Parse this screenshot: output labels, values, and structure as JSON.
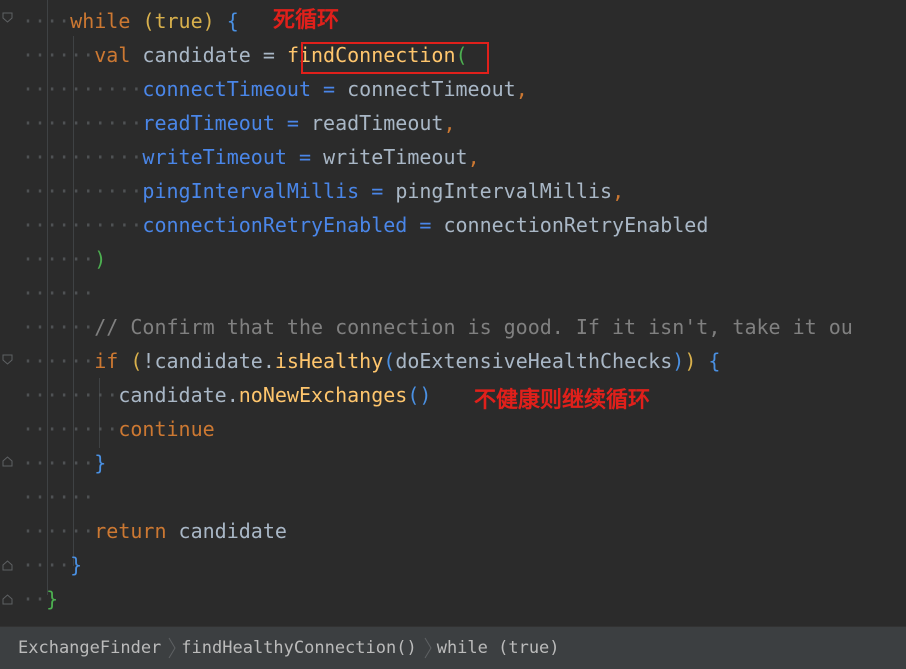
{
  "code": {
    "while_kw": "while",
    "while_cond": "(true)",
    "open_brace": "{",
    "annot_loop": "死循环",
    "val_kw": "val",
    "candidate_var": "candidate",
    "eq": "=",
    "find_fn": "findConnection",
    "open_paren": "(",
    "args": [
      {
        "name": "connectTimeout",
        "eq": "=",
        "value": "connectTimeout",
        "comma": ","
      },
      {
        "name": "readTimeout",
        "eq": "=",
        "value": "readTimeout",
        "comma": ","
      },
      {
        "name": "writeTimeout",
        "eq": "=",
        "value": "writeTimeout",
        "comma": ","
      },
      {
        "name": "pingIntervalMillis",
        "eq": "=",
        "value": "pingIntervalMillis",
        "comma": ","
      },
      {
        "name": "connectionRetryEnabled",
        "eq": "=",
        "value": "connectionRetryEnabled",
        "comma": ""
      }
    ],
    "close_paren": ")",
    "comment": "// Confirm that the connection is good. If it isn't, take it ou",
    "if_kw": "if",
    "if_open": "(",
    "if_neg": "!candidate.",
    "is_healthy_fn": "isHealthy",
    "is_healthy_open": "(",
    "is_healthy_arg": "doExtensiveHealthChecks",
    "is_healthy_close": ")",
    "if_close": ")",
    "if_brace": "{",
    "no_new_obj": "candidate.",
    "no_new_fn": "noNewExchanges",
    "no_new_parens": "()",
    "annot_continue": "不健康则继续循环",
    "continue_kw": "continue",
    "if_end_brace": "}",
    "return_kw": "return",
    "return_val": "candidate",
    "while_end_brace": "}",
    "fn_end_brace": "}"
  },
  "breadcrumb": {
    "items": [
      "ExchangeFinder",
      "findHealthyConnection()",
      "while (true)"
    ]
  },
  "colors": {
    "background": "#2b2b2b",
    "keyword": "#cc7832",
    "function": "#ffc66d",
    "parameter": "#4a86e8",
    "comment": "#808080",
    "annotation": "#e0201b"
  }
}
